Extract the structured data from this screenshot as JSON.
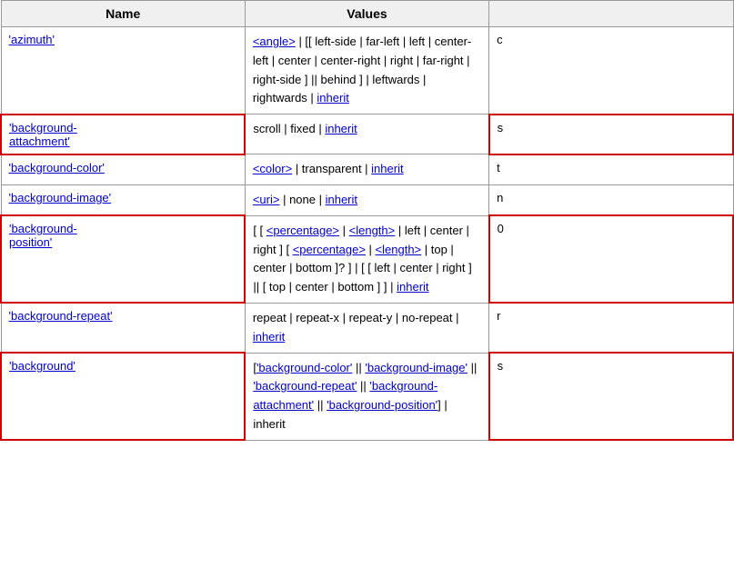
{
  "table": {
    "columns": [
      {
        "label": "Name",
        "key": "name"
      },
      {
        "label": "Values",
        "key": "values"
      },
      {
        "label": "",
        "key": "initial"
      }
    ],
    "rows": [
      {
        "id": "azimuth",
        "name_text": "'azimuth'",
        "name_link": true,
        "highlighted": false,
        "values_html": "<a href='#'>&lt;angle&gt;</a> | [[ left-side | far-left | left | center-left | center | center-right | right | far-right | right-side ] || behind ] | leftwards | rightwards | <a href='#'>inherit</a>",
        "initial": "c"
      },
      {
        "id": "background-attachment",
        "name_text": "'background-attachment'",
        "name_link": true,
        "highlighted": true,
        "values_html": "scroll | fixed | <a href='#'>inherit</a>",
        "initial": "s"
      },
      {
        "id": "background-color",
        "name_text": "'background-color'",
        "name_link": true,
        "highlighted": false,
        "values_html": "<a href='#'>&lt;color&gt;</a> | transparent | <a href='#'>inherit</a>",
        "initial": "t"
      },
      {
        "id": "background-image",
        "name_text": "'background-image'",
        "name_link": true,
        "highlighted": false,
        "values_html": "<a href='#'>&lt;uri&gt;</a> | none | <a href='#'>inherit</a>",
        "initial": "n"
      },
      {
        "id": "background-position",
        "name_text": "'background-position'",
        "name_link": true,
        "highlighted": true,
        "values_html": "[ [ <a href='#'>&lt;percentage&gt;</a> | <a href='#'>&lt;length&gt;</a> | left | center | right ] [ <a href='#'>&lt;percentage&gt;</a> | <a href='#'>&lt;length&gt;</a> | top | center | bottom ]? ] | [ [ left | center | right ] || [ top | center | bottom ] ] | <a href='#'>inherit</a>",
        "initial": "0"
      },
      {
        "id": "background-repeat",
        "name_text": "'background-repeat'",
        "name_link": true,
        "highlighted": false,
        "values_html": "repeat | repeat-x | repeat-y | no-repeat | <a href='#'>inherit</a>",
        "initial": "r"
      },
      {
        "id": "background",
        "name_text": "'background'",
        "name_link": true,
        "highlighted": true,
        "values_html": "[<a href='#'>'background-color'</a> || <a href='#'>'background-image'</a> || <a href='#'>'background-repeat'</a> || <a href='#'>'background-attachment'</a> || <a href='#'>'background-position'</a>] | inherit",
        "initial": "s"
      }
    ]
  }
}
